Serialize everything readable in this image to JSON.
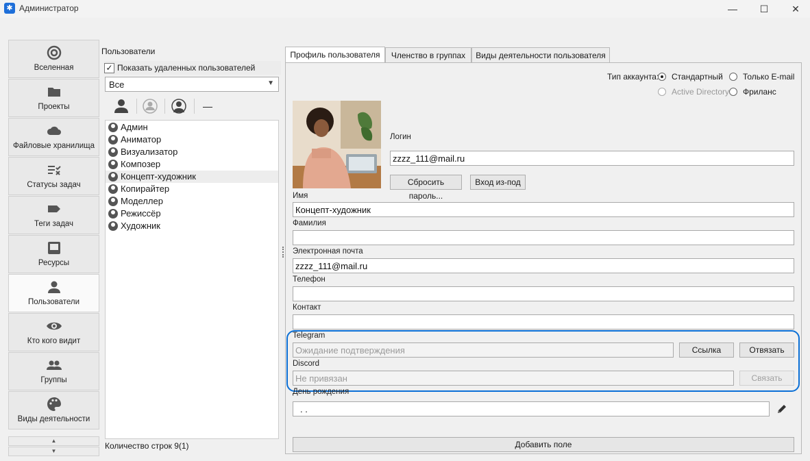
{
  "window": {
    "title": "Администратор",
    "minimize": "—",
    "maximize": "☐",
    "close": "✕"
  },
  "nav": {
    "items": [
      {
        "label": "Вселенная",
        "icon": "spiral-icon"
      },
      {
        "label": "Проекты",
        "icon": "folder-icon"
      },
      {
        "label": "Файловые хранилища",
        "icon": "cloud-icon"
      },
      {
        "label": "Статусы задач",
        "icon": "status-list-icon"
      },
      {
        "label": "Теги задач",
        "icon": "tag-icon"
      },
      {
        "label": "Ресурсы",
        "icon": "inbox-icon"
      },
      {
        "label": "Пользователи",
        "icon": "user-icon"
      },
      {
        "label": "Кто кого видит",
        "icon": "eye-icon"
      },
      {
        "label": "Группы",
        "icon": "group-icon"
      },
      {
        "label": "Виды деятельности",
        "icon": "palette-icon"
      }
    ],
    "active_index": 6,
    "scroll_up": "▲",
    "scroll_down": "▼"
  },
  "users_panel": {
    "title": "Пользователи",
    "show_deleted_label": "Показать удаленных пользователей",
    "show_deleted_checked": "✓",
    "filter_value": "Все",
    "filter_arrow": "▼",
    "remove_symbol": "—",
    "users": [
      "Админ",
      "Аниматор",
      "Визуализатор",
      "Композер",
      "Концепт-художник",
      "Копирайтер",
      "Моделлер",
      "Режиссёр",
      "Художник"
    ],
    "selected_index": 4,
    "row_count": "Количество строк 9(1)"
  },
  "tabs": [
    "Профиль пользователя",
    "Членство в группах",
    "Виды деятельности пользователя"
  ],
  "profile": {
    "account_type_label": "Тип аккаунта:",
    "account_types": {
      "standard": "Стандартный",
      "email_only": "Только E-mail",
      "active_directory": "Active Directory",
      "freelance": "Фриланс"
    },
    "login_label": "Логин",
    "login_value": "zzzz_111@mail.ru",
    "reset_password_button": "Сбросить пароль...",
    "login_as_button": "Вход из-под",
    "name_label": "Имя",
    "name_value": "Концепт-художник",
    "surname_label": "Фамилия",
    "surname_value": "",
    "email_label": "Электронная почта",
    "email_value": "zzzz_111@mail.ru",
    "phone_label": "Телефон",
    "phone_value": "",
    "contact_label": "Контакт",
    "contact_value": "",
    "telegram_label": "Telegram",
    "telegram_value": "Ожидание подтверждения",
    "telegram_link_button": "Ссылка",
    "telegram_unlink_button": "Отвязать",
    "discord_label": "Discord",
    "discord_value": "Не привязан",
    "discord_link_button": "Связать",
    "birthday_label": "День рождения",
    "birthday_value": ".  .",
    "add_field_button": "Добавить поле"
  },
  "colors": {
    "highlight": "#0a6fd6"
  }
}
